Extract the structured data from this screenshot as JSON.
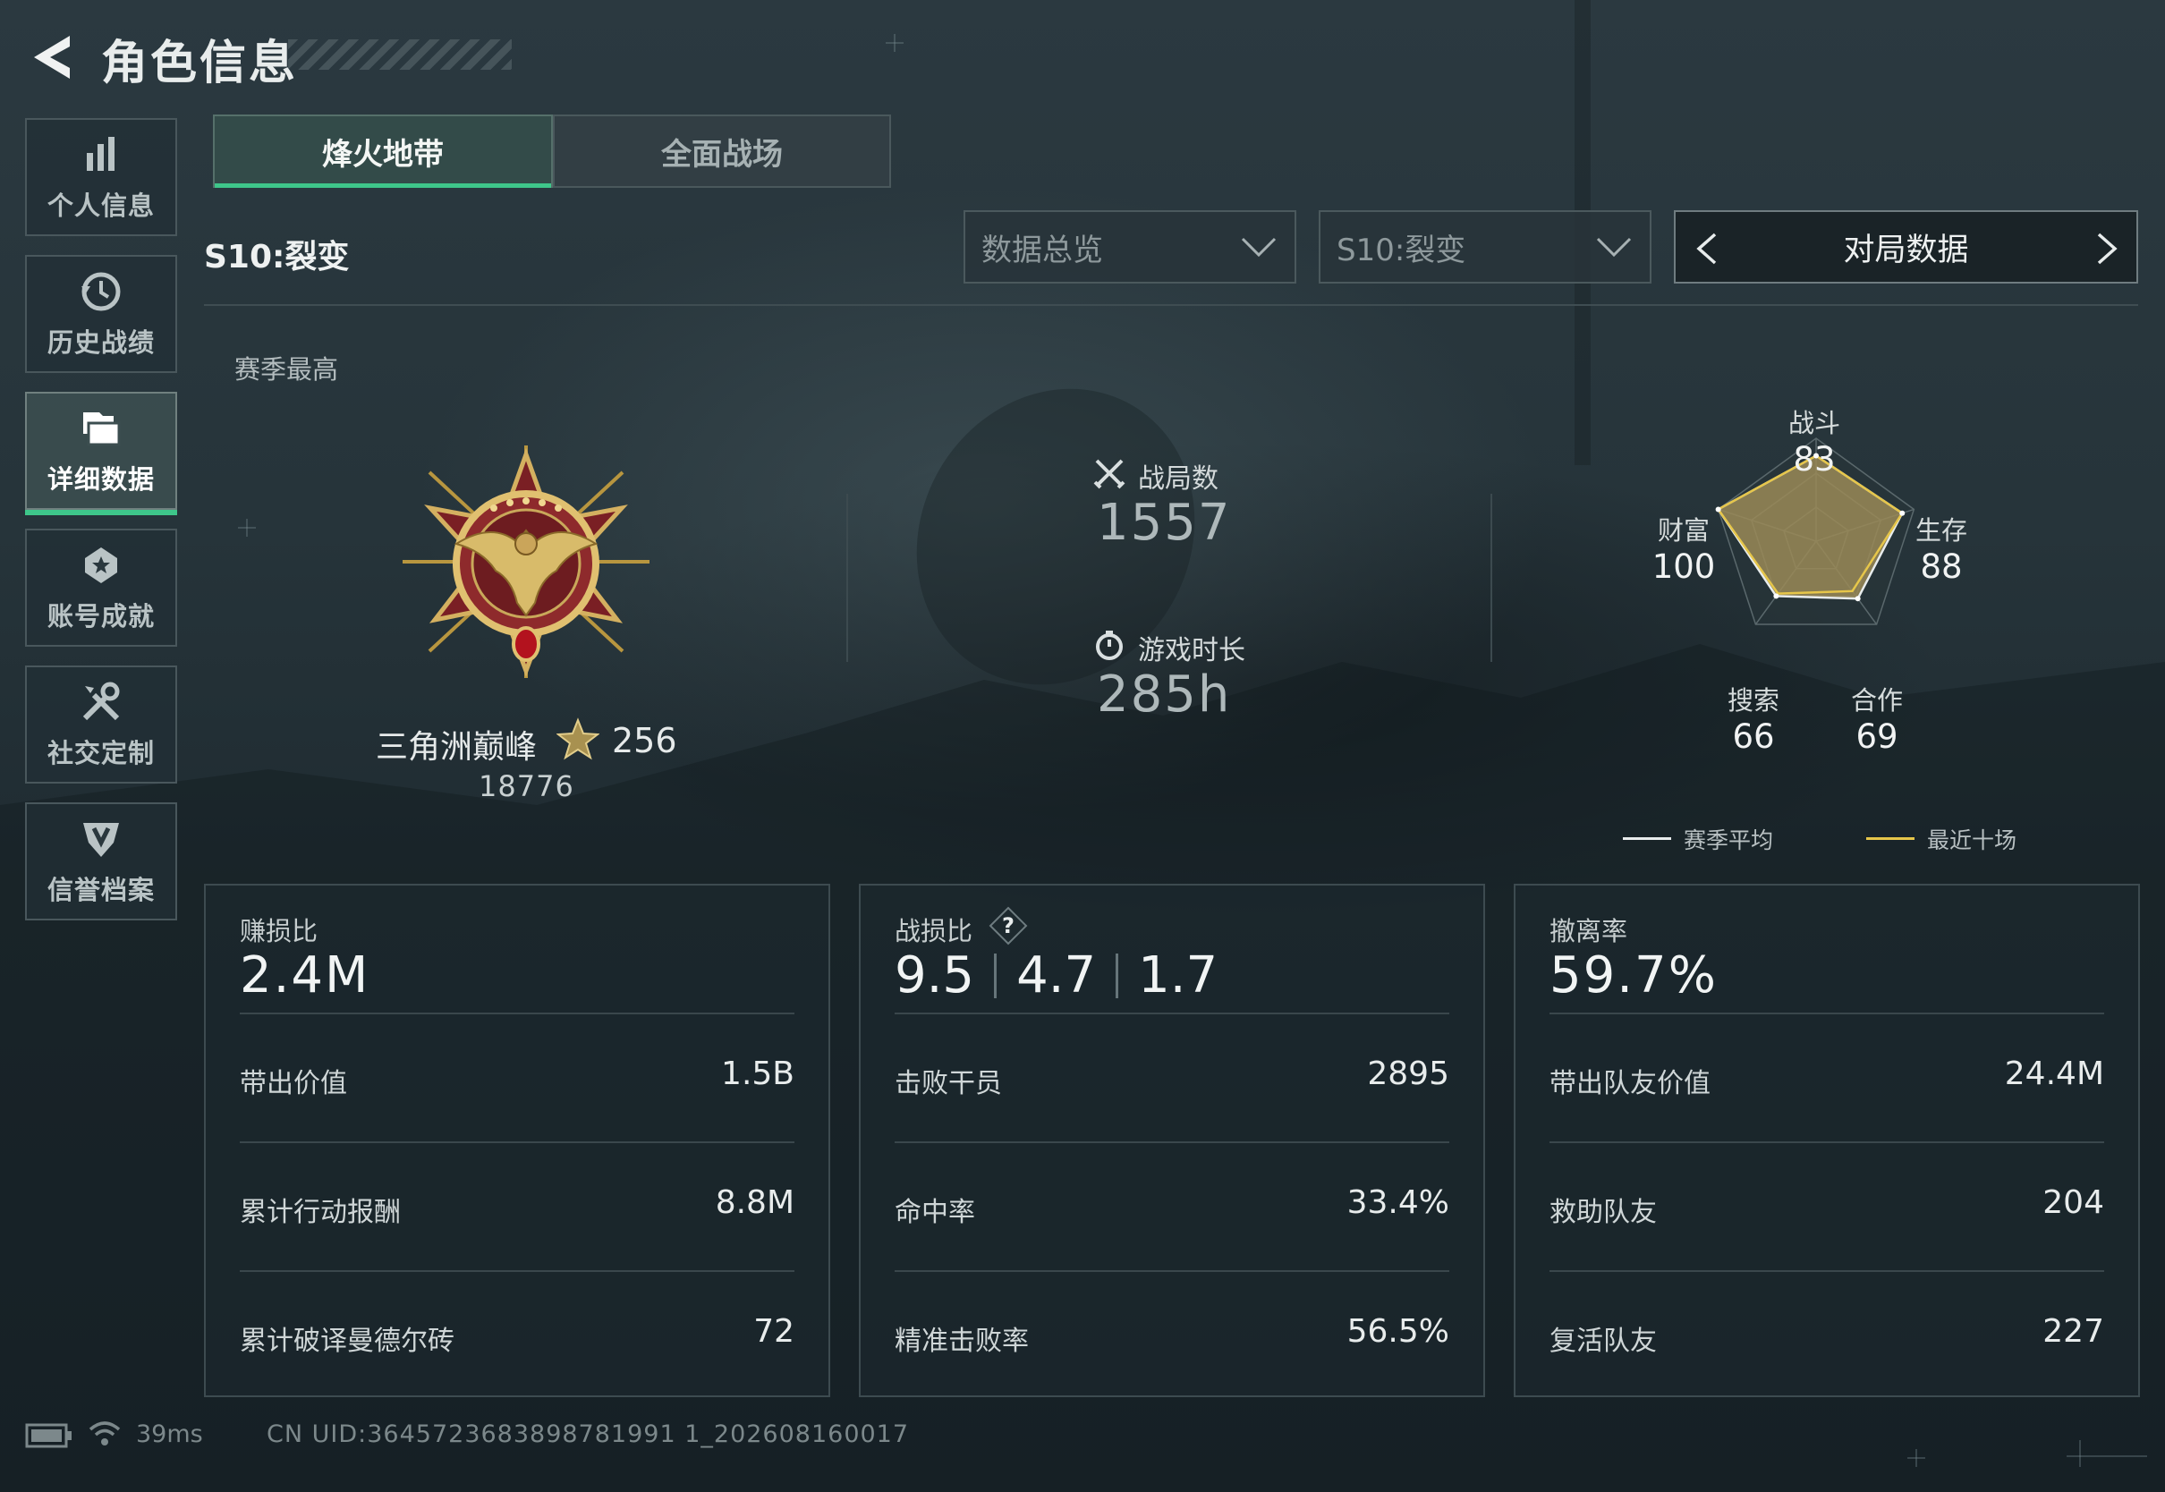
{
  "header": {
    "title": "角色信息"
  },
  "sidebar": {
    "items": [
      {
        "label": "个人信息",
        "icon": "bar-chart-icon",
        "active": false
      },
      {
        "label": "历史战绩",
        "icon": "history-icon",
        "active": false
      },
      {
        "label": "详细数据",
        "icon": "folder-icon",
        "active": true
      },
      {
        "label": "账号成就",
        "icon": "achievement-icon",
        "active": false
      },
      {
        "label": "社交定制",
        "icon": "tools-icon",
        "active": false
      },
      {
        "label": "信誉档案",
        "icon": "shield-icon",
        "active": false
      }
    ]
  },
  "tabs": [
    {
      "label": "烽火地带",
      "active": true
    },
    {
      "label": "全面战场",
      "active": false
    }
  ],
  "season_label": "S10:裂变",
  "filters": {
    "view_select": "数据总览",
    "season_select": "S10:裂变",
    "pager_label": "对局数据"
  },
  "best": {
    "label": "赛季最高",
    "rank_name": "三角洲巅峰",
    "stars": "256",
    "score": "18776"
  },
  "middle": {
    "matches_label": "战局数",
    "matches_value": "1557",
    "playtime_label": "游戏时长",
    "playtime_value": "285h"
  },
  "radar": {
    "axes": [
      {
        "label": "战斗",
        "value": "83"
      },
      {
        "label": "生存",
        "value": "88"
      },
      {
        "label": "合作",
        "value": "69"
      },
      {
        "label": "搜索",
        "value": "66"
      },
      {
        "label": "财富",
        "value": "100"
      }
    ],
    "season_avg_values": [
      83,
      88,
      69,
      66,
      100
    ],
    "recent10_values": [
      83,
      88,
      60,
      63,
      100
    ],
    "legend": {
      "season_avg": "赛季平均",
      "recent10": "最近十场"
    },
    "colors": {
      "fill": "#9a8a57",
      "season_avg": "#e8ecec",
      "recent10": "#e6c64a"
    }
  },
  "cards": [
    {
      "label": "赚损比",
      "big": "2.4M",
      "rows": [
        {
          "label": "带出价值",
          "value": "1.5B"
        },
        {
          "label": "累计行动报酬",
          "value": "8.8M"
        },
        {
          "label": "累计破译曼德尔砖",
          "value": "72"
        }
      ]
    },
    {
      "label": "战损比",
      "kd": [
        "9.5",
        "4.7",
        "1.7"
      ],
      "rows": [
        {
          "label": "击败干员",
          "value": "2895"
        },
        {
          "label": "命中率",
          "value": "33.4%"
        },
        {
          "label": "精准击败率",
          "value": "56.5%"
        }
      ]
    },
    {
      "label": "撤离率",
      "big": "59.7%",
      "rows": [
        {
          "label": "带出队友价值",
          "value": "24.4M"
        },
        {
          "label": "救助队友",
          "value": "204"
        },
        {
          "label": "复活队友",
          "value": "227"
        }
      ]
    }
  ],
  "footer": {
    "ping": "39ms",
    "uid": "CN UID:3645723683898781991 1_202608160017"
  },
  "colors": {
    "accent": "#3ec68a",
    "gold": "#c9a85a"
  }
}
